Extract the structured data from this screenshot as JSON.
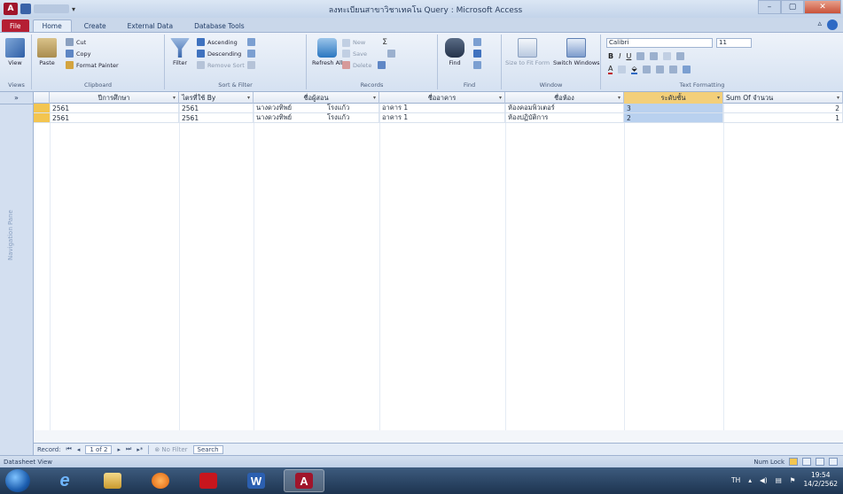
{
  "window": {
    "title": "ลงทะเบียนสาขาวิชาเทคโน Query : Microsoft Access",
    "minimize": "–",
    "maximize": "▢",
    "close": "✕"
  },
  "ribbon_tabs": [
    "File",
    "Home",
    "Create",
    "External Data",
    "Database Tools"
  ],
  "ribbon": {
    "view": {
      "label": "View",
      "group": "Views"
    },
    "clipboard": {
      "paste": "Paste",
      "cut": "Cut",
      "copy": "Copy",
      "format_painter": "Format Painter",
      "group": "Clipboard"
    },
    "sort_filter": {
      "filter": "Filter",
      "ascending": "Ascending",
      "descending": "Descending",
      "remove_sort": "Remove Sort",
      "group": "Sort & Filter"
    },
    "records": {
      "refresh_all": "Refresh All",
      "new": "New",
      "save": "Save",
      "delete": "Delete",
      "group": "Records"
    },
    "find": {
      "find": "Find",
      "group": "Find"
    },
    "window": {
      "size_to_fit": "Size to Fit Form",
      "switch_windows": "Switch Windows",
      "group": "Window"
    },
    "text_formatting": {
      "font": "Calibri",
      "size": "11",
      "group": "Text Formatting"
    }
  },
  "nav_pane": {
    "label": "Navigation Pane",
    "toggle": "»"
  },
  "grid": {
    "columns": [
      "ปีการศึกษา",
      "ไตรที่ใช้ By",
      "ชื่อผู้สอน",
      "ชื่ออาคาร",
      "ชื่อห้อง",
      "ระดับชั้น",
      "Sum Of จำนวน"
    ],
    "rows": [
      [
        "2561",
        "2561",
        "นางดวงทิพย์",
        "โรงแก้ว",
        "อาคาร 1",
        "ห้องคอมพิวเตอร์",
        "3",
        "2"
      ],
      [
        "2561",
        "2561",
        "นางดวงทิพย์",
        "โรงแก้ว",
        "อาคาร 1",
        "ห้องปฏิบัติการ",
        "2",
        "1"
      ]
    ]
  },
  "record_nav": {
    "prefix": "Record:",
    "position": "1 of 2",
    "filter": "No Filter",
    "search": "Search"
  },
  "status": {
    "left": "Datasheet View",
    "right": "Num Lock"
  },
  "taskbar": {
    "language": "TH",
    "time": "19:54",
    "date": "14/2/2562"
  }
}
